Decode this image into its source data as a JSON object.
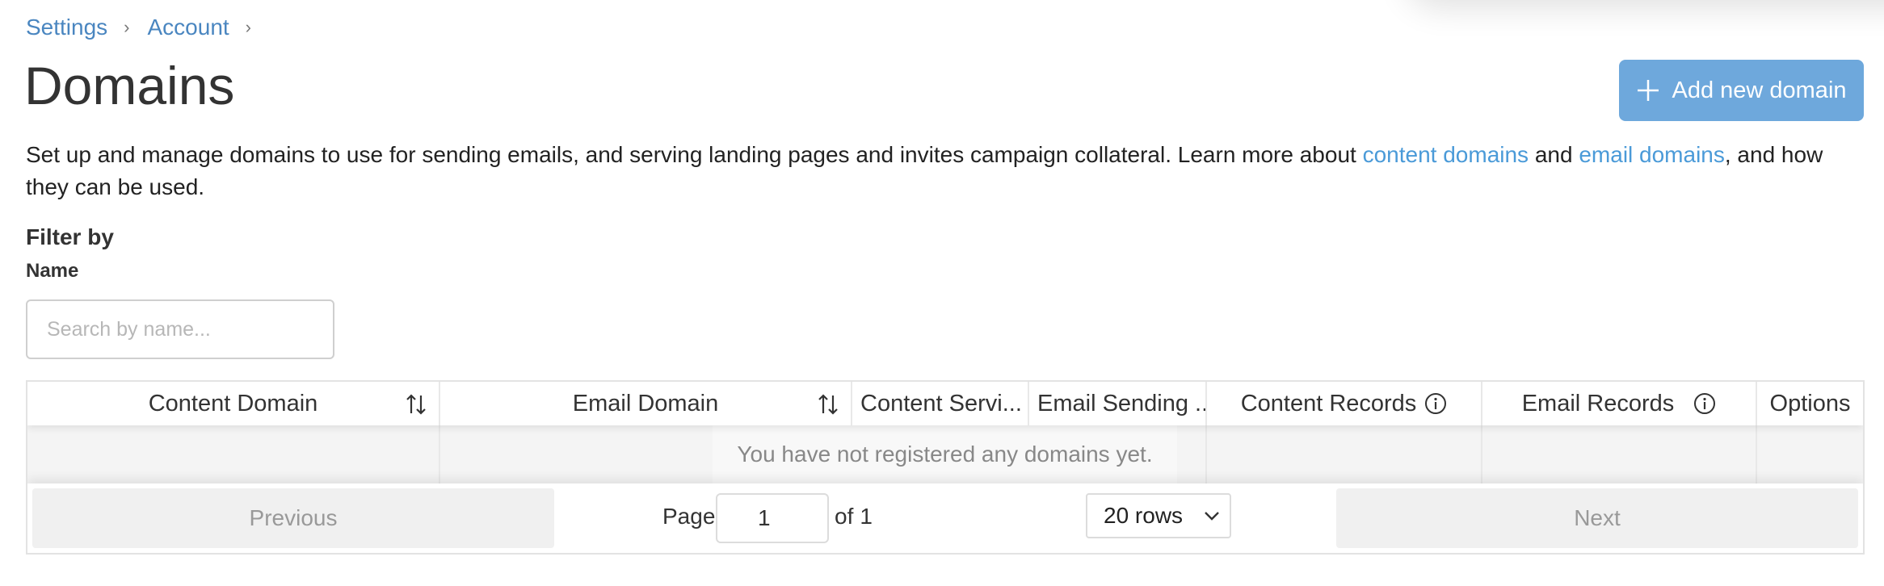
{
  "breadcrumb": {
    "items": [
      {
        "label": "Settings"
      },
      {
        "label": "Account"
      }
    ],
    "separator": "›"
  },
  "page": {
    "title": "Domains",
    "add_button_label": "Add new domain",
    "description_before": "Set up and manage domains to use for sending emails, and serving landing pages and invites campaign collateral. Learn more about ",
    "link_content_domains": "content domains",
    "description_middle": " and ",
    "link_email_domains": "email domains",
    "description_after": ", and how they can be used."
  },
  "filter": {
    "title": "Filter by",
    "name_label": "Name",
    "search_placeholder": "Search by name...",
    "search_value": ""
  },
  "table": {
    "columns": [
      {
        "label": "Content Domain",
        "sortable": true,
        "icon": "sort-icon"
      },
      {
        "label": "Email Domain",
        "sortable": true,
        "icon": "sort-icon"
      },
      {
        "label": "Content Servi..."
      },
      {
        "label": "Email Sending ..."
      },
      {
        "label": "Content Records",
        "icon": "info-icon"
      },
      {
        "label": "Email Records",
        "icon": "info-icon"
      },
      {
        "label": "Options"
      }
    ],
    "empty_message": "You have not registered any domains yet."
  },
  "pagination": {
    "previous_label": "Previous",
    "next_label": "Next",
    "page_label": "Page",
    "current_page": "1",
    "of_label": "of",
    "total_pages": "1",
    "rows_option": "20 rows"
  },
  "colors": {
    "accent": "#6ea8dc",
    "link": "#4a86c0",
    "text": "#333333"
  }
}
